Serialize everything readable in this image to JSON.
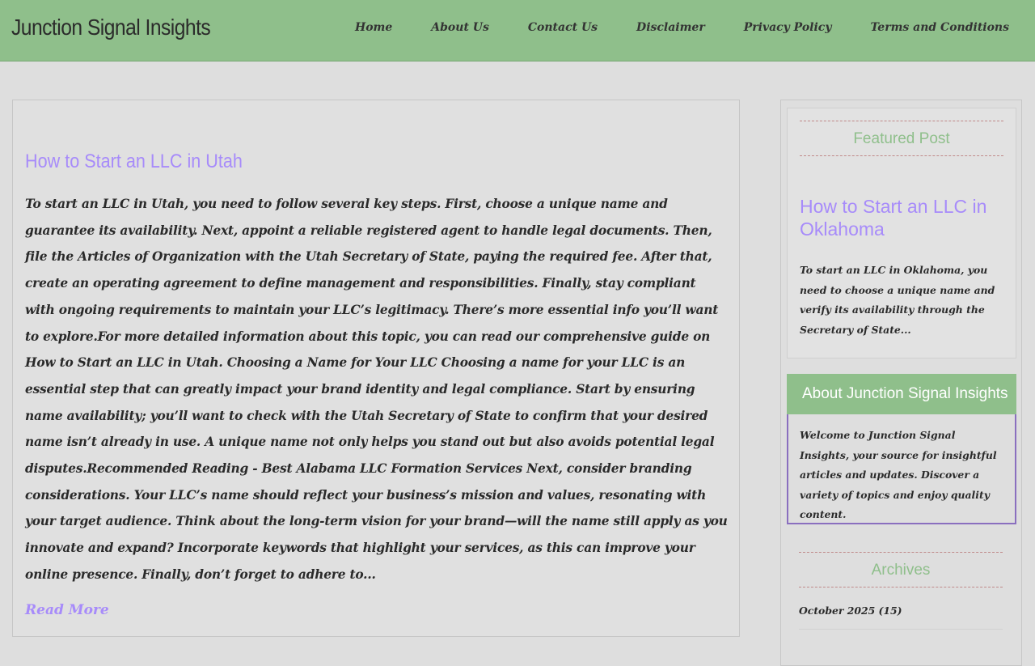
{
  "header": {
    "site_title": "Junction Signal Insights",
    "nav": [
      "Home",
      "About Us",
      "Contact Us",
      "Disclaimer",
      "Privacy Policy",
      "Terms and Conditions"
    ]
  },
  "post": {
    "title": "How to Start an LLC in Utah",
    "excerpt": "To start an LLC in Utah, you need to follow several key steps. First, choose a unique name and guarantee its availability. Next, appoint a reliable registered agent to handle legal documents. Then, file the Articles of Organization with the Utah Secretary of State, paying the required fee. After that, create an operating agreement to define management and responsibilities. Finally, stay compliant with ongoing requirements to maintain your LLC’s legitimacy. There’s more essential info you’ll want to explore.For more detailed information about this topic, you can read our comprehensive guide on How to Start an LLC in Utah. Choosing a Name for Your LLC Choosing a name for your LLC is an essential step that can greatly impact your brand identity and legal compliance. Start by ensuring name availability; you’ll want to check with the Utah Secretary of State to confirm that your desired name isn’t already in use. A unique name not only helps you stand out but also avoids potential legal disputes.Recommended Reading - Best Alabama LLC Formation Services Next, consider branding considerations. Your LLC’s name should reflect your business’s mission and values, resonating with your target audience. Think about the long-term vision for your brand—will the name still apply as you innovate and expand? Incorporate keywords that highlight your services, as this can improve your online presence. Finally, don’t forget to adhere to...",
    "read_more": "Read More"
  },
  "sidebar": {
    "featured_heading": "Featured Post",
    "featured_title": "How to Start an LLC in Oklahoma",
    "featured_excerpt": "To start an LLC in Oklahoma, you need to choose a unique name and verify its availability through the Secretary of State...",
    "about_heading": "About Junction Signal Insights",
    "about_text": "Welcome to Junction Signal Insights, your source for insightful articles and updates. Discover a variety of topics and enjoy quality content.",
    "archives_heading": "Archives",
    "archives": [
      "October 2025 (15)"
    ]
  },
  "colors": {
    "header_bg": "#8fbf8b",
    "link": "#a78bfa",
    "page_bg": "#dedede"
  }
}
